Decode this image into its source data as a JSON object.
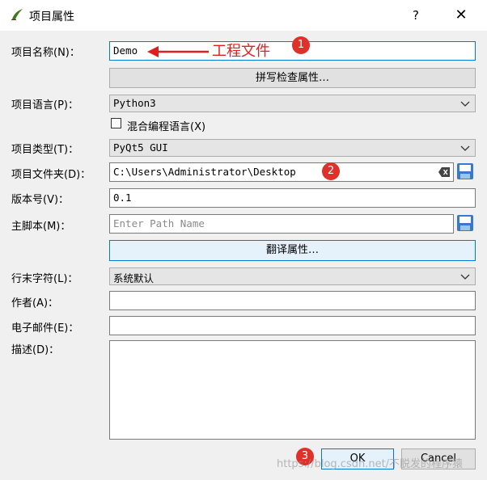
{
  "window": {
    "title": "项目属性",
    "help": "?",
    "close": "✕"
  },
  "fields": {
    "name": {
      "label": "项目名称(N)：",
      "value": "Demo"
    },
    "spell_button": "拼写检查属性…",
    "language": {
      "label": "项目语言(P)：",
      "value": "Python3"
    },
    "mixed": {
      "label": "混合编程语言(X)",
      "checked": false
    },
    "type": {
      "label": "项目类型(T)：",
      "value": "PyQt5 GUI"
    },
    "folder": {
      "label": "项目文件夹(D)：",
      "value": "C:\\Users\\Administrator\\Desktop"
    },
    "version": {
      "label": "版本号(V)：",
      "value": "0.1"
    },
    "main_script": {
      "label": "主脚本(M)：",
      "placeholder": "Enter Path Name"
    },
    "translate_button": "翻译属性…",
    "eol": {
      "label": "行末字符(L)：",
      "value": "系统默认"
    },
    "author": {
      "label": "作者(A)：",
      "value": ""
    },
    "email": {
      "label": "电子邮件(E)：",
      "value": ""
    },
    "description": {
      "label": "描述(D)：",
      "value": ""
    }
  },
  "buttons": {
    "ok": "OK",
    "cancel": "Cancel"
  },
  "annotations": {
    "arrow_text": "工程文件",
    "badge1": "1",
    "badge2": "2",
    "badge3": "3"
  },
  "watermark": "https://blog.csdn.net/不脱发的程序猿",
  "colors": {
    "accent": "#0078d7",
    "annotation": "#e02020"
  }
}
